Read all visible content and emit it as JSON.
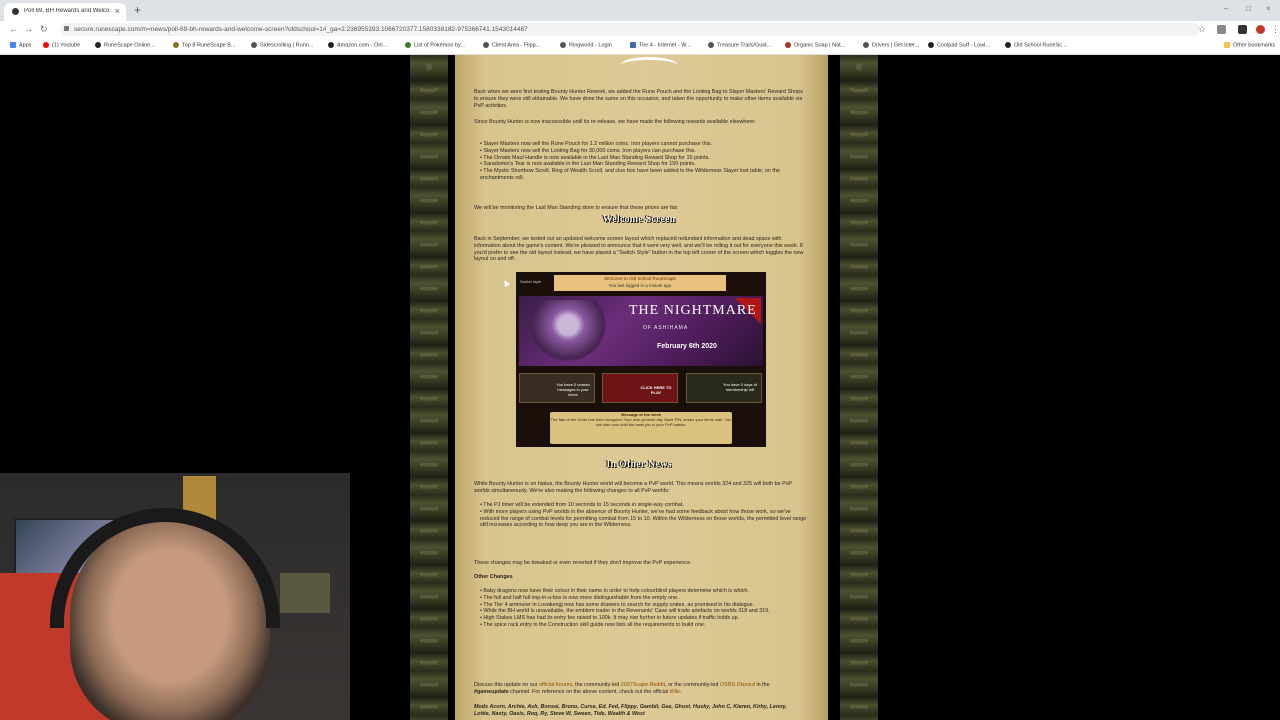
{
  "browser": {
    "tab_title": "Poll 69, BH Rewards and Welco...",
    "new_tab": "+",
    "url": "secure.runescape.com/m=news/poll-69-bh-rewards-and-welcome-screen?oldschool=1#_ga=2.236955393.1066720377.1580338182-975366741.1543014487",
    "window_controls": [
      "–",
      "□",
      "×"
    ],
    "bookmarks": [
      {
        "label": "Apps",
        "color": "#4285f4"
      },
      {
        "label": "(1) Youtube",
        "color": "#ff0000"
      },
      {
        "label": "RuneScape Online...",
        "color": "#222222"
      },
      {
        "label": "Top 8 RuneScape B...",
        "color": "#8a6d2b"
      },
      {
        "label": "Sidescrolling | Runn...",
        "color": "#555555"
      },
      {
        "label": "Amazon.com - Onl...",
        "color": "#222222"
      },
      {
        "label": "List of Pokémon by...",
        "color": "#3a7d2a"
      },
      {
        "label": "Client Area - Flipp...",
        "color": "#555555"
      },
      {
        "label": "Ringworld - Login",
        "color": "#555555"
      },
      {
        "label": "Tier 4 - Internet - W...",
        "color": "#4466aa"
      },
      {
        "label": "Treasure Trails/Guid...",
        "color": "#555555"
      },
      {
        "label": "Organic Soap | Nat...",
        "color": "#aa3322"
      },
      {
        "label": "Drivers | Get inter...",
        "color": "#555555"
      },
      {
        "label": "Coolpad Surf - Lowl...",
        "color": "#222222"
      },
      {
        "label": "Old School RuneSc...",
        "color": "#222222"
      },
      {
        "label": "Other bookmarks",
        "color": "#f2c14e"
      }
    ]
  },
  "article": {
    "intro_p1": "Back when we were first testing Bounty Hunter Rework, we added the Rune Pouch and the Looting Bag to Slayer Masters' Reward Shops to ensure they were still obtainable. We have done the same on this occasion, and taken the opportunity to make other items available via PvP activities.",
    "intro_p2": "Since Bounty Hunter is now inaccessible until its re-release, we have made the following rewards available elsewhere:",
    "rewards": [
      "Slayer Masters now sell the Rune Pouch for 1.2 million coins. Iron players cannot purchase this.",
      "Slayer Masters now sell the Looting Bag for 30,000 coins. Iron players can purchase this.",
      "The Ornate Maul Handle is now available in the Last Man Standing Reward Shop for 15 points.",
      "Saradomin's Tear is now available in the Last Man Standing Reward Shop for 150 points.",
      "The Mystic Shortbow Scroll, Ring of Wealth Scroll, and clue box have been added to the Wilderness Slayer loot table, on the enchantments roll."
    ],
    "monitor_note": "We will be monitoring the Last Man Standing store to ensure that these prices are fair.",
    "welcome_heading": "Welcome Screen",
    "welcome_text": "Back in September, we tested out an updated welcome screen layout which replaced redundant information and dead space with information about the game's content. We're pleased to announce that it went very well, and we'll be rolling it out for everyone this week. If you'd prefer to see the old layout instead, we have placed a \"Switch Style\" button in the top left corner of the screen which toggles the new layout on and off.",
    "welcome_image": {
      "switch_style": "Switch style",
      "top_line1": "Welcome to Old School RuneScape",
      "top_line2": "You last logged in a minute ago",
      "banner_title": "THE NIGHTMARE",
      "banner_sub": "OF ASHIHAMA",
      "banner_date": "February 6th 2020",
      "tile1": "You have 0 unread messages in your inbox",
      "tile2": "CLICK HERE TO PLAY",
      "tile3": "You have 0 days of membership left",
      "message_title": "Message of the week",
      "message_text": "The fate of the Gods has been foregone! Your ever-present ally, Bank PIN, keeps your items safe. You can also now hold the bank pin to your PvP battles."
    },
    "news_heading": "In Other News",
    "news_p1": "While Bounty Hunter is on hiatus, the Bounty Hunter world will become a PvP world. This means worlds 324 and 325 will both be PvP worlds simultaneously. We're also making the following changes to all PvP worlds:",
    "pvp_changes": [
      "The PJ timer will be extended from 10 seconds to 15 seconds in single-way combat.",
      "With more players using PvP worlds in the absence of Bounty Hunter, we've had some feedback about how those work, so we've reduced the range of combat levels for permitting combat from 15 to 10. Within the Wilderness on those worlds, the permitted level range still increases according to how deep you are in the Wilderness."
    ],
    "news_p2": "These changes may be tweaked or even reverted if they don't improve the PvP experience.",
    "other_changes_heading": "Other Changes",
    "other_changes": [
      "Baby dragons now have their colour in their name in order to help colourblind players determine which is which.",
      "The full and half full imp-in-a-box is now more distinguishable from the empty one.",
      "The Tier 4 armourer in Lovakengj now has some drawers to search for supply crates, as promised in his dialogue.",
      "While the BH world is unavailable, the emblem trader in the Revenants' Cave will trade artefacts on worlds 318 and 319.",
      "High Stakes LMS has had its entry fee raised to 100k. It may rise further in future updates if traffic holds up.",
      "The spice rack entry in the Construction skill guide now lists all the requirements to build one."
    ],
    "discuss_pre": "Discuss this update on our ",
    "discuss_link1": "official forums",
    "discuss_mid1": ", the community-led ",
    "discuss_link2": "2007Scape Reddit",
    "discuss_mid2": ", or the community-led ",
    "discuss_link3": "OSRS Discord",
    "discuss_mid3": " in the ",
    "discuss_channel": "#gameupdate",
    "discuss_post": " channel. For reference on the above content, check out the official ",
    "discuss_link4": "Wiki",
    "discuss_end": ".",
    "mods": "Mods Acorn, Archie, Ash, Bonsai, Bruno, Curse, Ed, Fed, Flippy, Gambit, Gee, Ghost, Husky, John C, Kieren, Kirby, Lenny, Lottie, Nasty, Oasis, Roq, Ry, Steve W, Sween, Tide, Wealth & West"
  }
}
